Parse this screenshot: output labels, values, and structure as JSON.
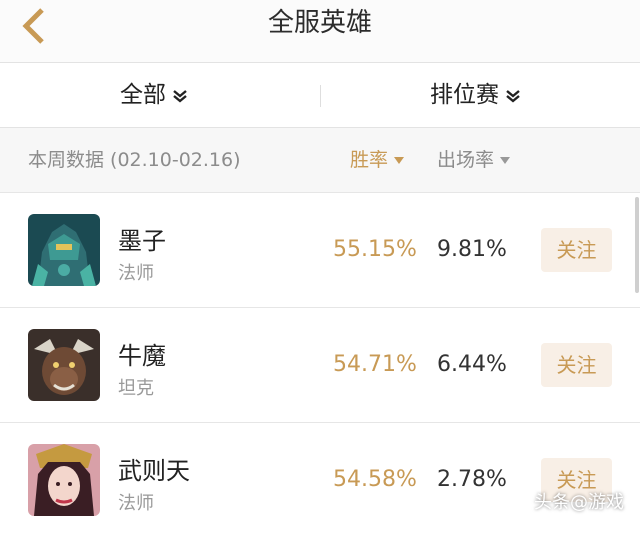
{
  "header": {
    "title": "全服英雄",
    "back_icon": "back-chevron-icon",
    "accent": "#c89a55"
  },
  "filters": {
    "scope": {
      "label": "全部",
      "icon": "double-chevron-down-icon"
    },
    "mode": {
      "label": "排位赛",
      "icon": "double-chevron-down-icon"
    }
  },
  "stats_header": {
    "period": "本周数据 (02.10-02.16)",
    "win_rate_label": "胜率",
    "pick_rate_label": "出场率",
    "sort_icon": "sort-down-triangle-icon"
  },
  "heroes": [
    {
      "name": "墨子",
      "role": "法师",
      "win_rate": "55.15%",
      "pick_rate": "9.81%",
      "follow_label": "关注"
    },
    {
      "name": "牛魔",
      "role": "坦克",
      "win_rate": "54.71%",
      "pick_rate": "6.44%",
      "follow_label": "关注"
    },
    {
      "name": "武则天",
      "role": "法师",
      "win_rate": "54.58%",
      "pick_rate": "2.78%",
      "follow_label": "关注"
    }
  ],
  "watermark": {
    "text": "头条@游戏"
  }
}
